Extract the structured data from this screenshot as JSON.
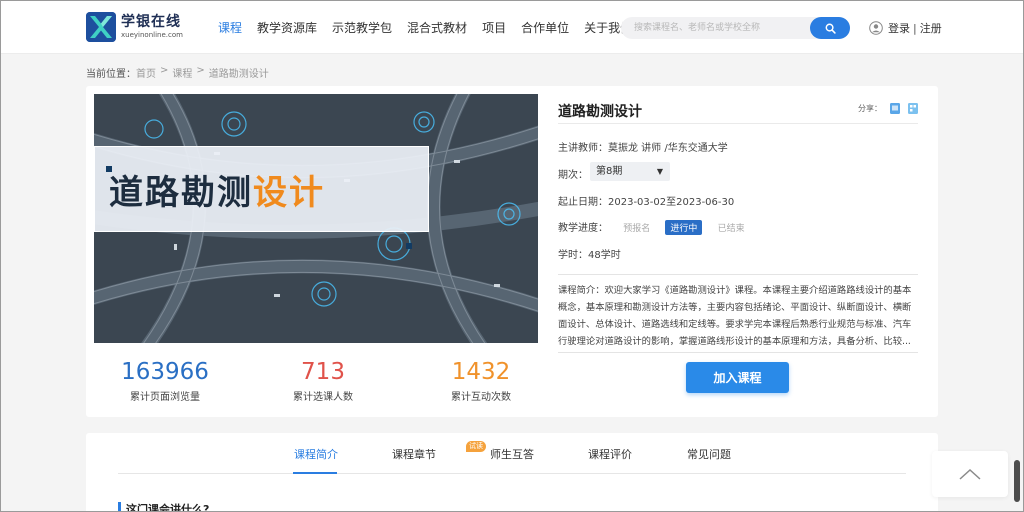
{
  "brand": {
    "name_cn": "学银在线",
    "name_en": "xueyinonline.com"
  },
  "nav": [
    "课程",
    "教学资源库",
    "示范教学包",
    "混合式教材",
    "项目",
    "合作单位",
    "关于我们"
  ],
  "search": {
    "placeholder": "搜索课程名、老师名或学校全称"
  },
  "user": {
    "login": "登录",
    "separator": "|",
    "register": "注册"
  },
  "breadcrumb": {
    "prefix": "当前位置：",
    "items": [
      "首页",
      "课程",
      "道路勘测设计"
    ],
    "sep": ">"
  },
  "cover": {
    "title_dark": "道路勘测",
    "title_orange": "设计"
  },
  "course": {
    "title": "道路勘测设计",
    "share_label": "分享：",
    "teacher_label": "主讲教师：",
    "teacher": "莫振龙 讲师 /华东交通大学",
    "term_label": "期次：",
    "term_value": "第8期",
    "dates_label": "起止日期：",
    "dates": "2023-03-02至2023-06-30",
    "progress_label": "教学进度：",
    "progress": [
      "预报名",
      "进行中",
      "已结束"
    ],
    "hours_label": "学时：",
    "hours": "48学时",
    "intro_label": "课程简介：",
    "intro": "欢迎大家学习《道路勘测设计》课程。本课程主要介绍道路路线设计的基本概念，基本原理和勘测设计方法等，主要内容包括绪论、平面设计、纵断面设计、横断面设计、总体设计、道路选线和定线等。要求学完本课程后熟悉行业规范与标准、汽车行驶理论对道路设计的影响，掌握道路线形设计的基本原理和方法，具备分析、比较..."
  },
  "stats": [
    {
      "value": "163966",
      "label": "累计页面浏览量",
      "color": "#2a6fc4"
    },
    {
      "value": "713",
      "label": "累计选课人数",
      "color": "#e0524a"
    },
    {
      "value": "1432",
      "label": "累计互动次数",
      "color": "#f0922b"
    }
  ],
  "join_button": "加入课程",
  "tabs": [
    "课程简介",
    "课程章节",
    "师生互答",
    "课程评价",
    "常见问题"
  ],
  "trial_badge": "试读",
  "section_title": "这门课会讲什么?",
  "colors": {
    "accent": "#2a7de1",
    "orange": "#f08a1d"
  }
}
